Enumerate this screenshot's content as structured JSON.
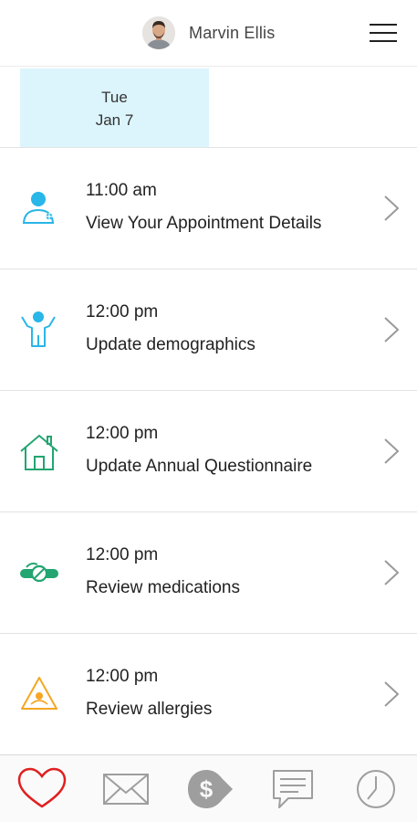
{
  "header": {
    "user_name": "Marvin Ellis",
    "avatar_icon": "user-avatar",
    "menu_icon": "hamburger-menu-icon"
  },
  "date_strip": {
    "selected": {
      "day_of_week": "Tue",
      "date": "Jan 7"
    },
    "highlight_color": "#dcf5fc"
  },
  "tasks": [
    {
      "time": "11:00 am",
      "title": "View Your Appointment Details",
      "icon": "doctor-icon",
      "color": "#29b6e8"
    },
    {
      "time": "12:00 pm",
      "title": "Update demographics",
      "icon": "person-icon",
      "color": "#29b6e8"
    },
    {
      "time": "12:00 pm",
      "title": "Update Annual Questionnaire",
      "icon": "house-icon",
      "color": "#23a571"
    },
    {
      "time": "12:00 pm",
      "title": "Review medications",
      "icon": "pills-icon",
      "color": "#23a571"
    },
    {
      "time": "12:00 pm",
      "title": "Review allergies",
      "icon": "allergy-warning-icon",
      "color": "#f5a623"
    }
  ],
  "bottom_nav": [
    {
      "icon": "heart-icon",
      "active": true,
      "color": "#e02020"
    },
    {
      "icon": "mail-icon",
      "active": false,
      "color": "#9e9e9e"
    },
    {
      "icon": "billing-dollar-icon",
      "active": false,
      "color": "#9e9e9e"
    },
    {
      "icon": "chat-icon",
      "active": false,
      "color": "#9e9e9e"
    },
    {
      "icon": "clock-icon",
      "active": false,
      "color": "#9e9e9e"
    }
  ]
}
